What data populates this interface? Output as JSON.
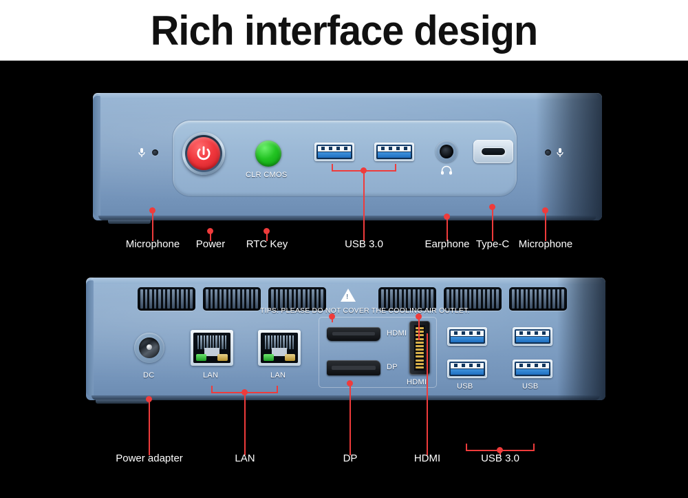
{
  "header": {
    "title": "Rich interface design"
  },
  "colors": {
    "accent_red": "#ef3b3b",
    "power_button_red": "#f0373d",
    "cmos_green": "#22c322",
    "usb3_blue": "#2a7fd4",
    "chassis_blue": "#8aaac9",
    "background": "#000000",
    "header_bg": "#ffffff"
  },
  "front_panel": {
    "name": "front-panel",
    "icons": [
      {
        "name": "microphone-icon",
        "side": "left"
      },
      {
        "name": "headphone-icon",
        "under": "earphone-jack"
      },
      {
        "name": "microphone-icon",
        "side": "right"
      }
    ],
    "silkscreen": {
      "cmos": "CLR  CMOS"
    },
    "ports": [
      {
        "id": "mic-left",
        "label": "Microphone",
        "type": "microphone"
      },
      {
        "id": "power",
        "label": "Power",
        "type": "power-button"
      },
      {
        "id": "rtc",
        "label": "RTC Key",
        "type": "cmos-button"
      },
      {
        "id": "usb3",
        "label": "USB 3.0",
        "type": "usb-a",
        "count": 2
      },
      {
        "id": "earphone",
        "label": "Earphone",
        "type": "audio-jack"
      },
      {
        "id": "typec",
        "label": "Type-C",
        "type": "usb-c"
      },
      {
        "id": "mic-right",
        "label": "Microphone",
        "type": "microphone"
      }
    ]
  },
  "rear_panel": {
    "name": "rear-panel",
    "warning": "TIPS: PLEASE DO NOT COVER THE COOLING AIR OUTLET.",
    "warning_icon": "warning-triangle-icon",
    "silkscreen": {
      "dc": "DC",
      "lan_left": "LAN",
      "lan_right": "LAN",
      "hdmi_h": "HDMI",
      "dp": "DP",
      "hdmi_v": "HDMI",
      "usb_left": "USB",
      "usb_right": "USB"
    },
    "vent_count": 6,
    "ports": [
      {
        "id": "dc",
        "label": "Power adapter",
        "type": "dc-jack"
      },
      {
        "id": "lan",
        "label": "LAN",
        "type": "rj45",
        "count": 2
      },
      {
        "id": "dp",
        "label": "DP",
        "type": "displayport"
      },
      {
        "id": "hdmi",
        "label": "HDMI",
        "type": "hdmi",
        "count": 2
      },
      {
        "id": "usb",
        "label": "USB 3.0",
        "type": "usb-a",
        "count": 4
      }
    ]
  }
}
